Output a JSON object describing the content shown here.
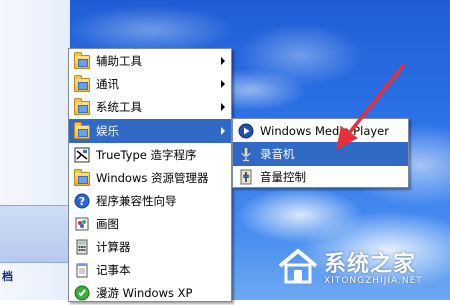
{
  "start_left": {
    "fragments": [
      "文档",
      "档"
    ]
  },
  "programs_menu": {
    "items": [
      {
        "label": "辅助工具",
        "icon": "folder-icon",
        "submenu": true
      },
      {
        "label": "通讯",
        "icon": "folder-icon",
        "submenu": true
      },
      {
        "label": "系统工具",
        "icon": "folder-icon",
        "submenu": true
      },
      {
        "label": "娱乐",
        "icon": "folder-icon",
        "submenu": true,
        "selected": true
      },
      {
        "label": "TrueType 造字程序",
        "icon": "truetype-editor-icon"
      },
      {
        "label": "Windows 资源管理器",
        "icon": "explorer-folder-icon"
      },
      {
        "label": "程序兼容性向导",
        "icon": "help-icon"
      },
      {
        "label": "画图",
        "icon": "paint-icon"
      },
      {
        "label": "计算器",
        "icon": "calculator-icon"
      },
      {
        "label": "记事本",
        "icon": "notepad-icon"
      },
      {
        "label": "漫游 Windows XP",
        "icon": "tour-icon"
      }
    ]
  },
  "entertainment_menu": {
    "items": [
      {
        "label": "Windows Media Player",
        "icon": "media-player-icon"
      },
      {
        "label": "录音机",
        "icon": "sound-recorder-icon",
        "selected": true
      },
      {
        "label": "音量控制",
        "icon": "volume-control-icon"
      }
    ]
  },
  "watermark": {
    "title": "系统之家",
    "subtitle": "XITONGZHIJIA.NET"
  },
  "colors": {
    "selection": "#316ac5",
    "annotation_arrow": "#e8303a",
    "desktop_blue": "#2e74e8"
  }
}
